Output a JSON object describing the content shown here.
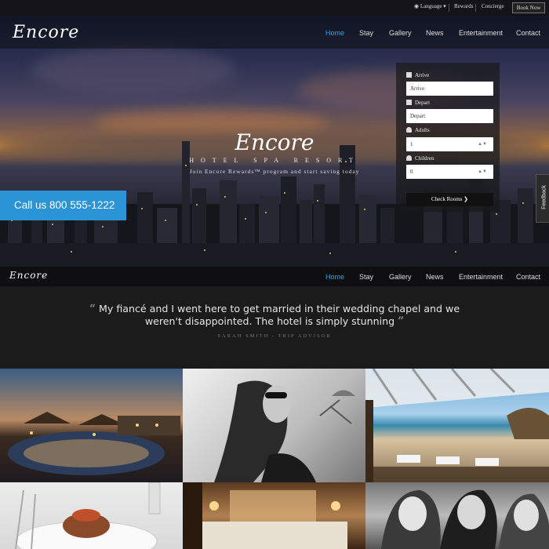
{
  "topbar": {
    "language": "Language",
    "rewards": "Rewards",
    "concierge": "Concierge",
    "book_now": "Book Now"
  },
  "brand": {
    "logo": "Encore",
    "subtitle": "HOTEL  SPA  RESORT",
    "tagline": "Join Encore Rewards™ program and start saving today"
  },
  "nav": {
    "items": [
      "Home",
      "Stay",
      "Gallery",
      "News",
      "Entertainment",
      "Contact"
    ],
    "active": "Home"
  },
  "hero": {
    "call_label": "Call us 800 555-1222"
  },
  "booking": {
    "arrive_label": "Arrive",
    "arrive_value": "Arrive",
    "depart_label": "Depart",
    "depart_value": "Depart",
    "adults_label": "Adults",
    "adults_value": "1",
    "children_label": "Children",
    "children_value": "0",
    "check_label": "Check Rooms"
  },
  "feedback": "Feedback",
  "testimonial": {
    "quote": "My fiancé and I went here to get married in their wedding chapel and we weren't disappointed. The hotel is simply stunning",
    "author": "SARAH SMITH - TRIP ADVISOR"
  },
  "colors": {
    "accent": "#2a94d6",
    "nav_active": "#3da0dc",
    "background": "#1b1b1b"
  },
  "icons": {
    "language": "globe-icon",
    "arrive": "calendar-icon",
    "depart": "calendar-icon",
    "adults": "person-icon",
    "children": "person-icon",
    "check": "chevron-right-icon",
    "quote_open": "quote-open-icon",
    "quote_close": "quote-close-icon"
  }
}
